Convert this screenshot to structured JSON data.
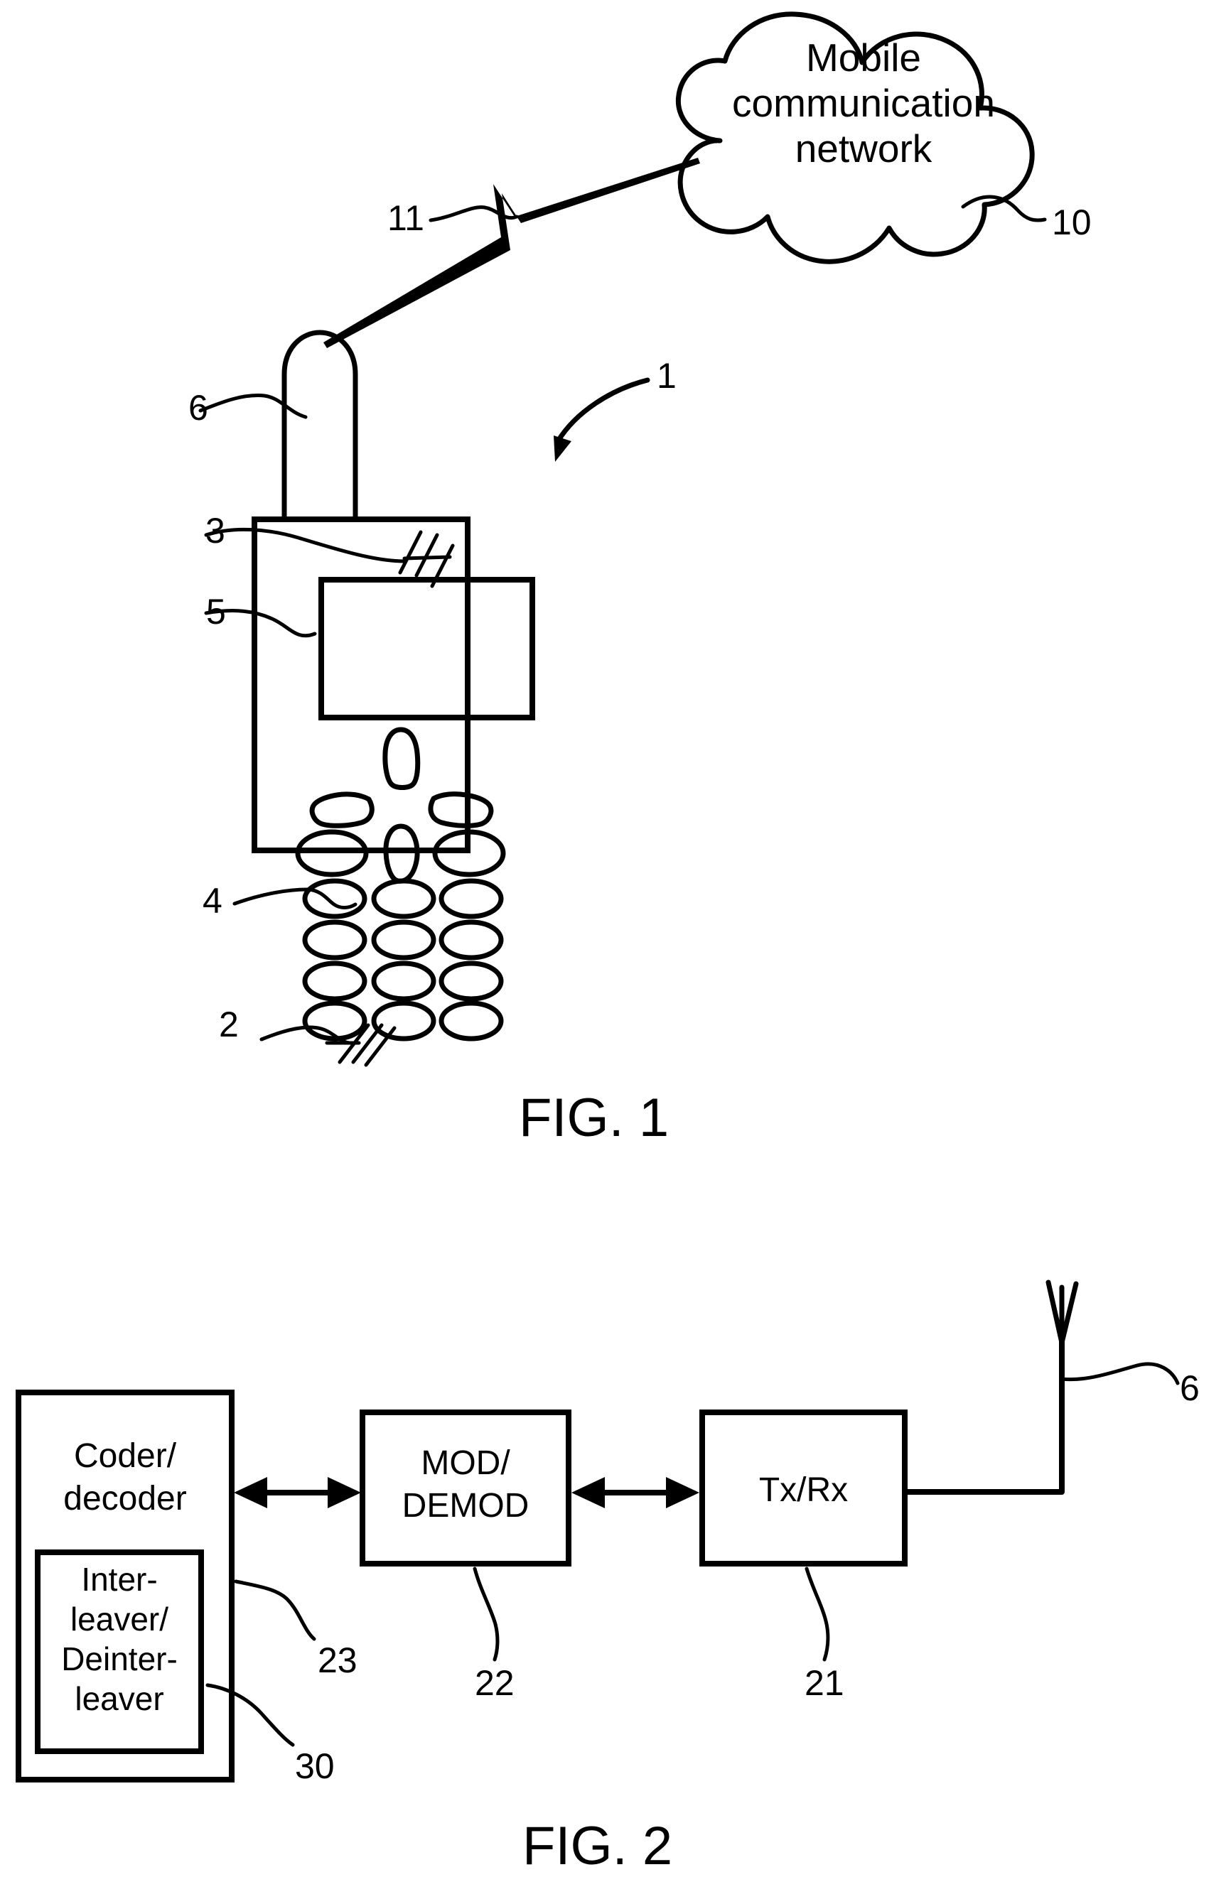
{
  "document": {
    "type": "patent-drawing-sheet",
    "figure_count": 2
  },
  "figure1": {
    "caption": "FIG. 1",
    "cloud": {
      "line1": "Mobile",
      "line2": "communication",
      "line3": "network",
      "reference": "10"
    },
    "references": {
      "device": "1",
      "radio_link": "11",
      "antenna": "6",
      "housing": "3",
      "display": "5",
      "keypad": "4",
      "body": "2"
    }
  },
  "figure2": {
    "caption": "FIG. 2",
    "blocks": [
      {
        "id": "coder-decoder",
        "label_line1": "Coder/",
        "label_line2": "decoder",
        "reference": "23"
      },
      {
        "id": "interleaver",
        "label_line1": "Inter-",
        "label_line2": "leaver/",
        "label_line3": "Deinter-",
        "label_line4": "leaver",
        "reference": "30"
      },
      {
        "id": "mod-demod",
        "label_line1": "MOD/",
        "label_line2": "DEMOD",
        "reference": "22"
      },
      {
        "id": "tx-rx",
        "label_line1": "Tx/Rx",
        "reference": "21"
      }
    ],
    "antenna": {
      "reference": "6"
    }
  },
  "colors": {
    "ink": "#000000",
    "paper": "#ffffff"
  }
}
